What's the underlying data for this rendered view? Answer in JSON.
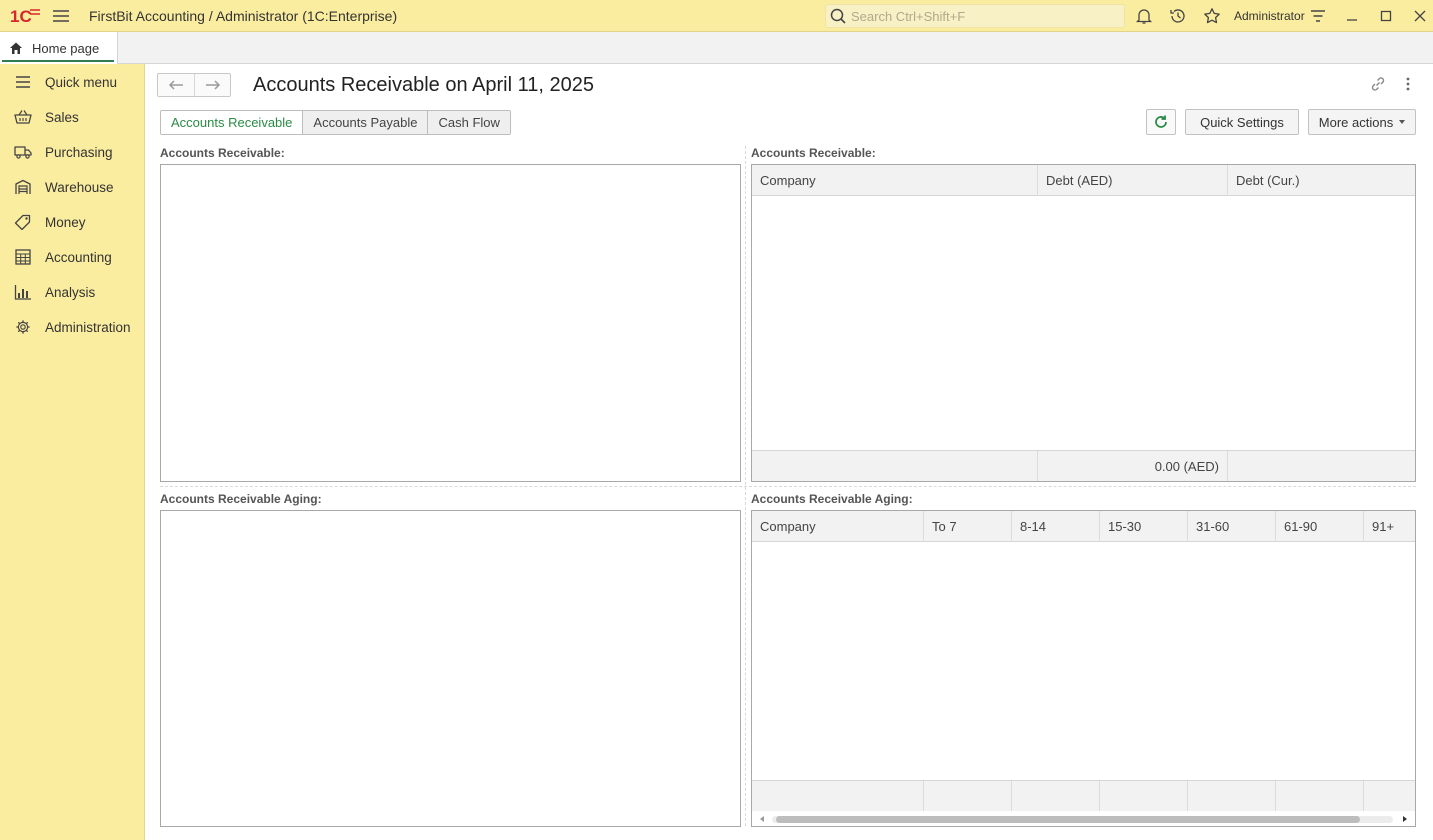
{
  "app": {
    "title": "FirstBit Accounting / Administrator  (1C:Enterprise)",
    "search_placeholder": "Search Ctrl+Shift+F",
    "user": "Administrator",
    "accent_color": "#2b8a46",
    "bar_color": "#fbeda0"
  },
  "tabs": {
    "home": "Home page"
  },
  "sidebar": {
    "items": [
      {
        "label": "Quick menu",
        "icon": "list-icon"
      },
      {
        "label": "Sales",
        "icon": "basket-icon"
      },
      {
        "label": "Purchasing",
        "icon": "truck-icon"
      },
      {
        "label": "Warehouse",
        "icon": "warehouse-icon"
      },
      {
        "label": "Money",
        "icon": "money-tag-icon"
      },
      {
        "label": "Accounting",
        "icon": "calculator-icon"
      },
      {
        "label": "Analysis",
        "icon": "bar-chart-icon"
      },
      {
        "label": "Administration",
        "icon": "gear-icon"
      }
    ]
  },
  "main": {
    "page_title": "Accounts Receivable on April 11, 2025",
    "segments": [
      "Accounts Receivable",
      "Accounts Payable",
      "Cash Flow"
    ],
    "quick_settings": "Quick Settings",
    "more_actions": "More actions",
    "panels": {
      "ar_chart_label": "Accounts Receivable:",
      "ar_table_label": "Accounts Receivable:",
      "aging_chart_label": "Accounts Receivable Aging:",
      "aging_table_label": "Accounts Receivable Aging:"
    },
    "ar_table": {
      "columns": [
        "Company",
        "Debt (AED)",
        "Debt (Cur.)"
      ],
      "footer_total": "0.00 (AED)"
    },
    "aging_table": {
      "columns": [
        "Company",
        "To 7",
        "8-14",
        "15-30",
        "31-60",
        "61-90",
        "91+"
      ]
    }
  }
}
